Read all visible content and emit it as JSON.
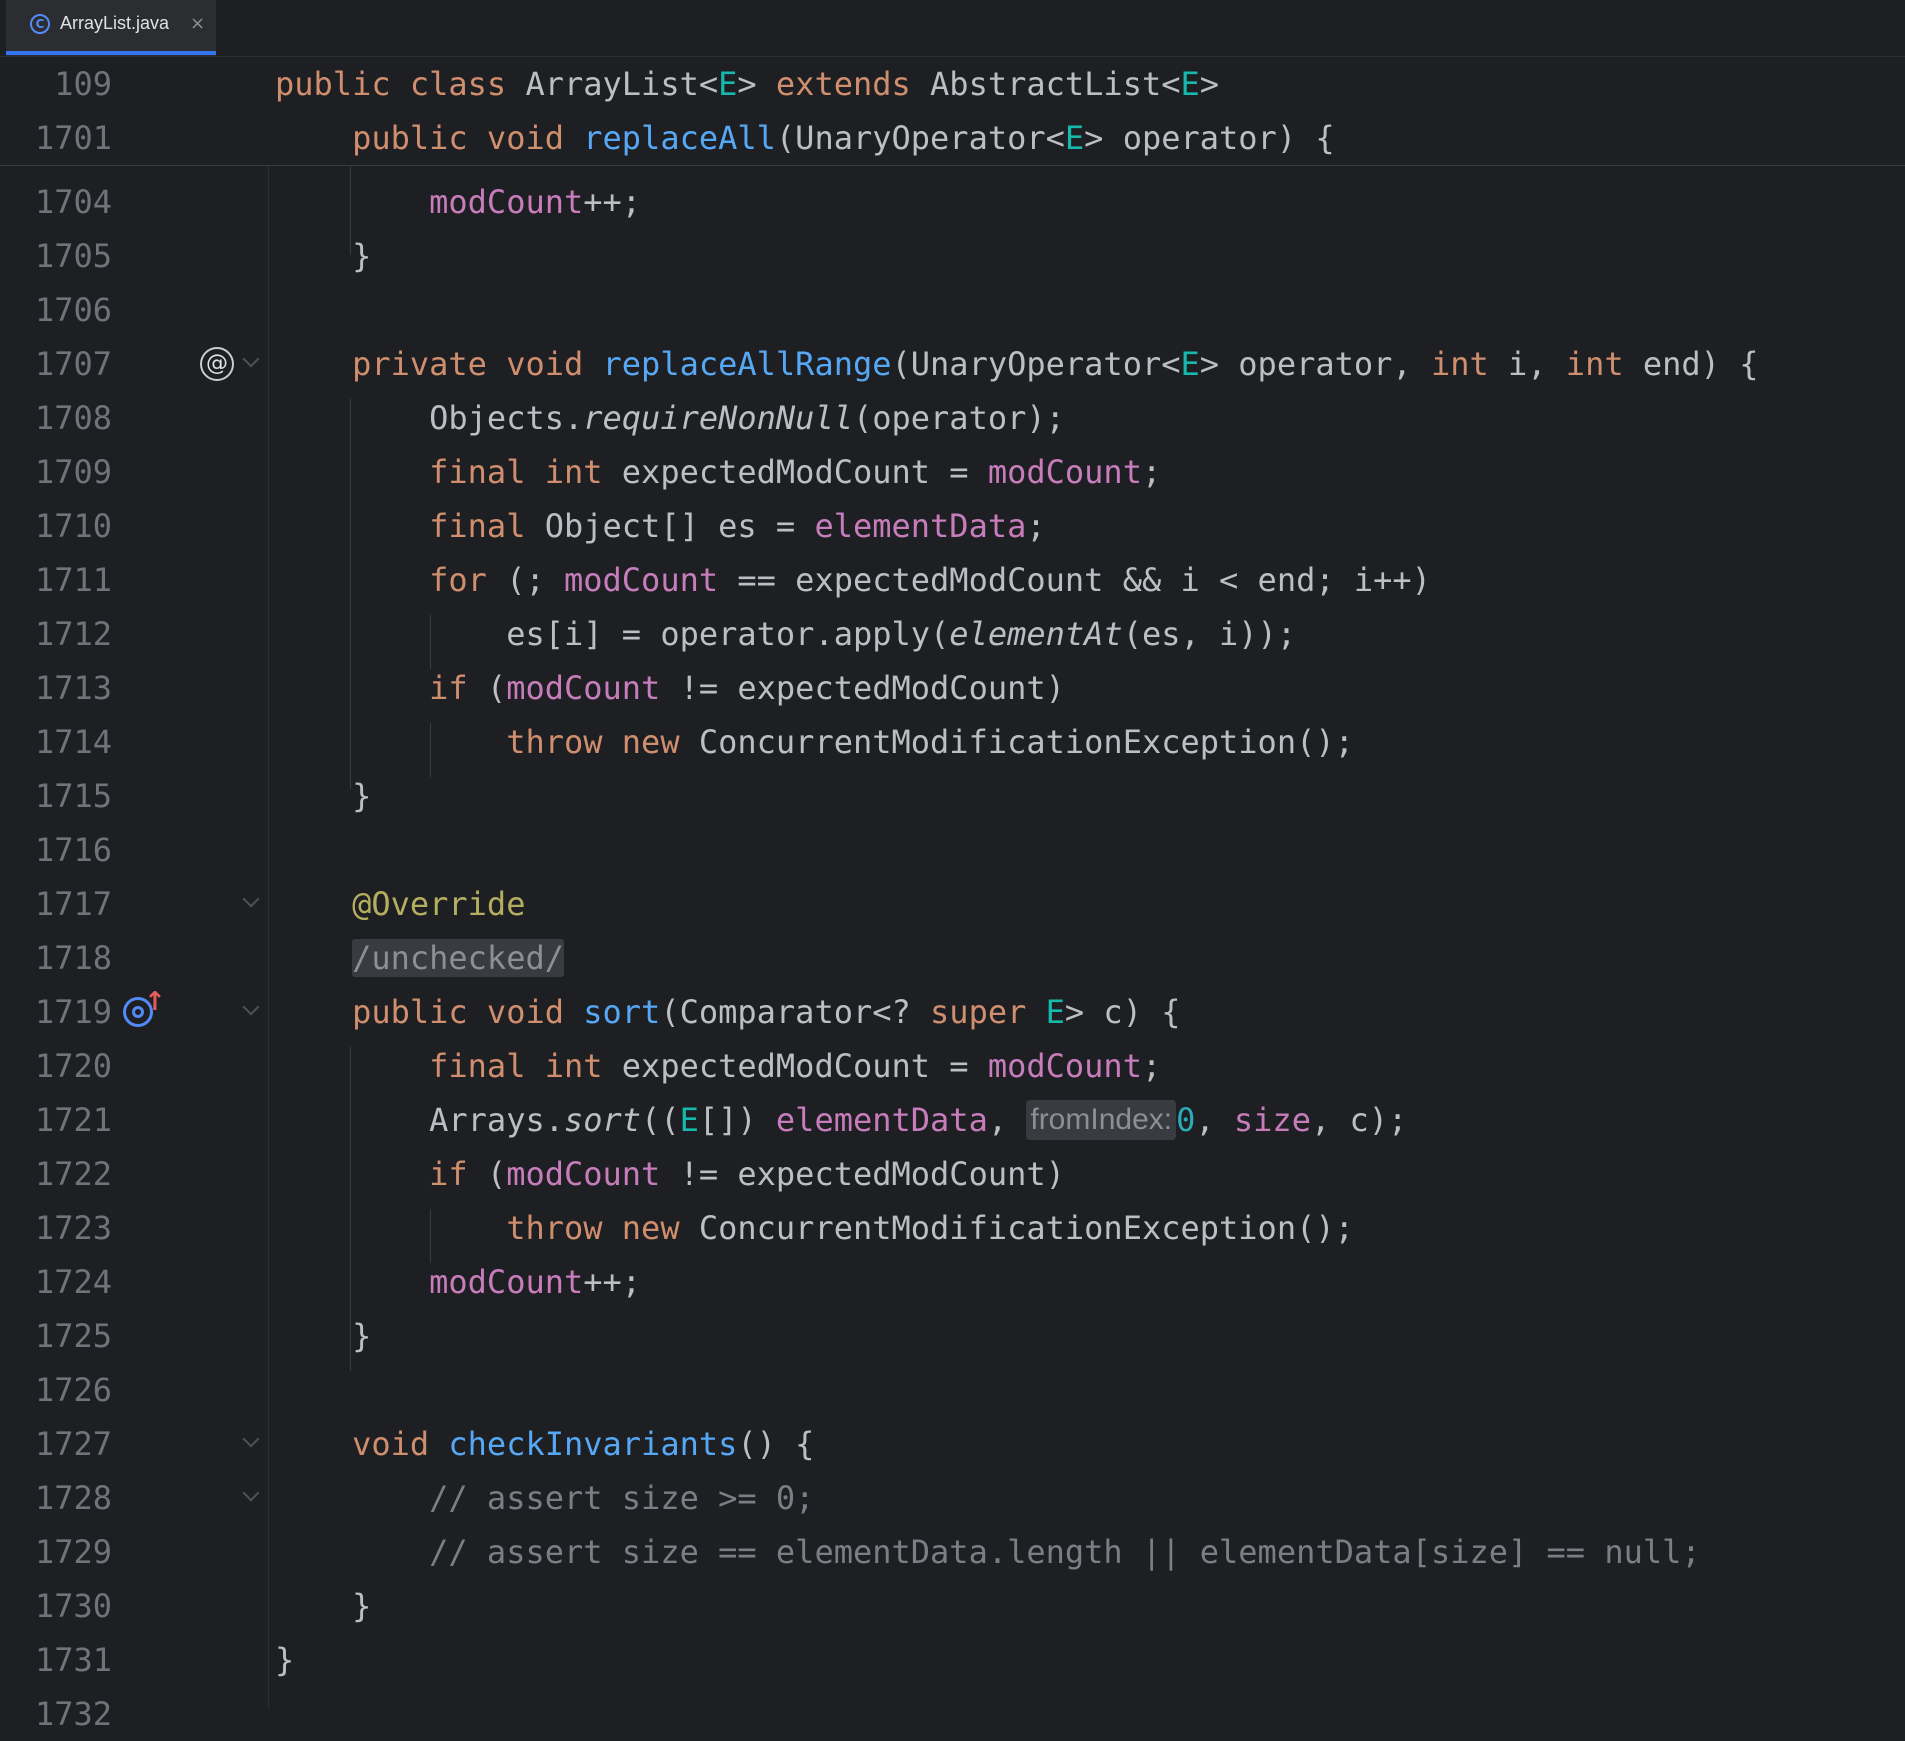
{
  "tab": {
    "title": "ArrayList.java",
    "icon": "class-icon",
    "close": "×"
  },
  "sticky": [
    {
      "ln": "109",
      "code": "public class ArrayList<E> extends AbstractList<E>"
    },
    {
      "ln": "1701",
      "code": "    public void replaceAll(UnaryOperator<E> operator) {"
    }
  ],
  "lines": [
    {
      "ln": "1704",
      "code": "        modCount++;"
    },
    {
      "ln": "1705",
      "code": "    }"
    },
    {
      "ln": "1706",
      "code": ""
    },
    {
      "ln": "1707",
      "code": "    private void replaceAllRange(UnaryOperator<E> operator, int i, int end) {"
    },
    {
      "ln": "1708",
      "code": "        Objects.requireNonNull(operator);"
    },
    {
      "ln": "1709",
      "code": "        final int expectedModCount = modCount;"
    },
    {
      "ln": "1710",
      "code": "        final Object[] es = elementData;"
    },
    {
      "ln": "1711",
      "code": "        for (; modCount == expectedModCount && i < end; i++)"
    },
    {
      "ln": "1712",
      "code": "            es[i] = operator.apply(elementAt(es, i));"
    },
    {
      "ln": "1713",
      "code": "        if (modCount != expectedModCount)"
    },
    {
      "ln": "1714",
      "code": "            throw new ConcurrentModificationException();"
    },
    {
      "ln": "1715",
      "code": "    }"
    },
    {
      "ln": "1716",
      "code": ""
    },
    {
      "ln": "1717",
      "code": "    @Override"
    },
    {
      "ln": "1718",
      "code": "    /unchecked/"
    },
    {
      "ln": "1719",
      "code": "    public void sort(Comparator<? super E> c) {"
    },
    {
      "ln": "1720",
      "code": "        final int expectedModCount = modCount;"
    },
    {
      "ln": "1721",
      "code": "        Arrays.sort((E[]) elementData, fromIndex:0, size, c);",
      "hint": "fromIndex:"
    },
    {
      "ln": "1722",
      "code": "        if (modCount != expectedModCount)"
    },
    {
      "ln": "1723",
      "code": "            throw new ConcurrentModificationException();"
    },
    {
      "ln": "1724",
      "code": "        modCount++;"
    },
    {
      "ln": "1725",
      "code": "    }"
    },
    {
      "ln": "1726",
      "code": ""
    },
    {
      "ln": "1727",
      "code": "    void checkInvariants() {"
    },
    {
      "ln": "1728",
      "code": "        // assert size >= 0;"
    },
    {
      "ln": "1729",
      "code": "        // assert size == elementData.length || elementData[size] == null;"
    },
    {
      "ln": "1730",
      "code": "    }"
    },
    {
      "ln": "1731",
      "code": "}"
    },
    {
      "ln": "1732",
      "code": ""
    }
  ],
  "gutter_icons": {
    "1707": "implements-interface-icon",
    "1719": "overrides-method-icon"
  },
  "colors": {
    "background": "#1e1f22",
    "keyword": "#cf8e6d",
    "function": "#56a8f5",
    "field": "#c77dbb",
    "type_param": "#16baac",
    "annotation": "#b3ae60",
    "comment": "#7a7e85",
    "accent": "#3574f0"
  }
}
